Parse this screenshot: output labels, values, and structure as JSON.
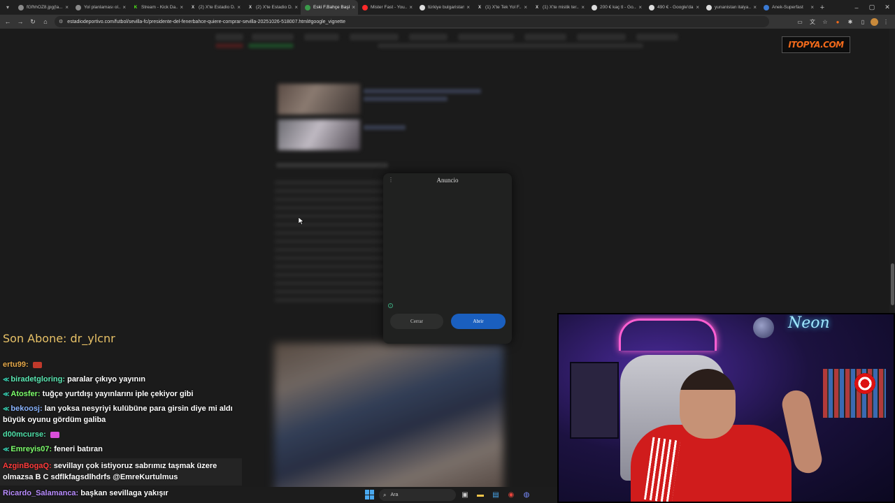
{
  "browser": {
    "tabs": [
      {
        "label": "fGfhhOZ8.jpg(la...",
        "favicon_color": "#8a8a8a",
        "glyph": "",
        "active": false
      },
      {
        "label": "Yol planlaması ol...",
        "favicon_color": "#8a8a8a",
        "glyph": "",
        "active": false
      },
      {
        "label": "Stream - Kick Da...",
        "favicon_color": "#53fc18",
        "glyph": "K",
        "active": false
      },
      {
        "label": "(2) X'te Estadio D...",
        "favicon_color": "#dddddd",
        "glyph": "X",
        "active": false
      },
      {
        "label": "(2) X'te Estadio D...",
        "favicon_color": "#dddddd",
        "glyph": "X",
        "active": false
      },
      {
        "label": "Eski F.Bahçe Başk...",
        "favicon_color": "#3a9a4a",
        "glyph": "",
        "active": true
      },
      {
        "label": "Mister Fast - You...",
        "favicon_color": "#ff2a2a",
        "glyph": "",
        "active": false
      },
      {
        "label": "türkiye bulgaristan...",
        "favicon_color": "#dddddd",
        "glyph": "",
        "active": false
      },
      {
        "label": "(1) X'te Tek Yol F...",
        "favicon_color": "#dddddd",
        "glyph": "X",
        "active": false
      },
      {
        "label": "(1) X'te mistik ter...",
        "favicon_color": "#dddddd",
        "glyph": "X",
        "active": false
      },
      {
        "label": "200 € kaç tl - Go...",
        "favicon_color": "#dddddd",
        "glyph": "",
        "active": false
      },
      {
        "label": "490 € - Google'da...",
        "favicon_color": "#dddddd",
        "glyph": "",
        "active": false
      },
      {
        "label": "yunanistan italya...",
        "favicon_color": "#dddddd",
        "glyph": "",
        "active": false
      },
      {
        "label": "Anek-Superfast",
        "favicon_color": "#3a7ad4",
        "glyph": "",
        "active": false
      }
    ],
    "url": "estadiodeportivo.com/futbol/sevilla-fc/presidente-del-fenerbahce-quiere-comprar-sevilla-20251026-518007.html#google_vignette"
  },
  "overlay_logo": "ITOPYA.COM",
  "ad_modal": {
    "title": "Anuncio",
    "close_label": "Cerrar",
    "open_label": "Abrir",
    "accent_color": "#1a5fbf"
  },
  "chat": {
    "sub_banner": "Son Abone: dr_ylcnr",
    "messages": [
      {
        "badge": "",
        "user": "ertu99:",
        "user_color": "#e6a94a",
        "text": "",
        "emote_color": "#c0392b",
        "highlight": false
      },
      {
        "badge": "≪",
        "user": "biradetgloring:",
        "user_color": "#5be8b3",
        "text": "paralar çıkıyo yayının",
        "emote_color": "",
        "highlight": false
      },
      {
        "badge": "≪",
        "user": "Atosfer:",
        "user_color": "#7dff6b",
        "text": "tuğçe yurtdışı yayınlarını iple çekiyor gibi",
        "emote_color": "",
        "highlight": false
      },
      {
        "badge": "≪",
        "user": "bekoosj:",
        "user_color": "#8ab4ff",
        "text": "lan yoksa nesyriyi kulübüne para girsin diye mi aldı büyük oyunu gördüm galiba",
        "emote_color": "",
        "highlight": false
      },
      {
        "badge": "",
        "user": "d00mcurse:",
        "user_color": "#4fe0a8",
        "text": "",
        "emote_color": "#d94fd9",
        "highlight": false
      },
      {
        "badge": "≪",
        "user": "Emreyis07:",
        "user_color": "#7dff6b",
        "text": "feneri batıran",
        "emote_color": "",
        "highlight": false
      },
      {
        "badge": "",
        "user": "AzginBogaQ:",
        "user_color": "#ff3b3b",
        "text": "sevillayı çok istiyoruz sabrımız taşmak üzere olmazsa B C sdflkfagsdlhdrfs @EmreKurtulmus",
        "emote_color": "",
        "highlight": true
      }
    ],
    "last_message": {
      "user": "Ricardo_Salamanca:",
      "user_color": "#b98cff",
      "text": "başkan sevillaga yakışır"
    }
  },
  "taskbar": {
    "search_placeholder": "Ara",
    "icons": [
      "widgets-icon",
      "task-view-icon",
      "file-explorer-icon",
      "store-icon",
      "chrome-icon",
      "discord-icon"
    ]
  },
  "webcam": {
    "neon_sign_text": "Neon"
  }
}
